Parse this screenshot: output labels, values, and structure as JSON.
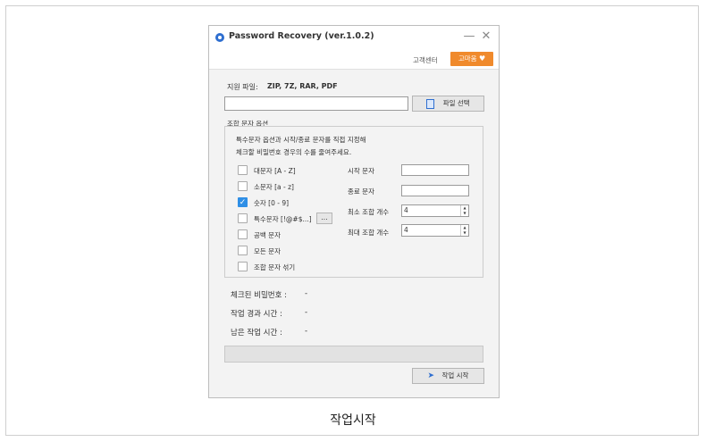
{
  "window": {
    "title": "Password Recovery (ver.1.0.2)",
    "minimize": "—",
    "close": "✕"
  },
  "header": {
    "support_label": "고객센터",
    "thanks_label": "고마움",
    "thanks_icon": "heart-icon"
  },
  "file": {
    "supported_label": "지원 파일:",
    "supported_types": "ZIP, 7Z, RAR, PDF",
    "path_value": "",
    "select_button": "파일 선택"
  },
  "options": {
    "group_title": "조합 문자 옵션",
    "description_1": "특수문자 옵션과 시작/종료 문자를 직접 지정해",
    "description_2": "체크할 비밀번호 경우의 수를 줄여주세요.",
    "checkboxes": [
      {
        "label": "대문자 [A - Z]",
        "checked": false
      },
      {
        "label": "소문자 [a - z]",
        "checked": false
      },
      {
        "label": "숫자 [0 - 9]",
        "checked": true
      },
      {
        "label": "특수문자 [!@#$...]",
        "checked": false
      },
      {
        "label": "공백 문자",
        "checked": false
      },
      {
        "label": "모든 문자",
        "checked": false
      },
      {
        "label": "조합 문자 섞기",
        "checked": false
      }
    ],
    "special_more_button": "...",
    "start_char_label": "시작 문자",
    "end_char_label": "종료 문자",
    "min_len_label": "최소 조합 개수",
    "max_len_label": "최대 조합 개수",
    "min_len_value": "4",
    "max_len_value": "4"
  },
  "status": {
    "checked_label": "체크된 비밀번호 :",
    "checked_value": "-",
    "elapsed_label": "작업 경과 시간 :",
    "elapsed_value": "-",
    "remaining_label": "남은 작업 시간 :",
    "remaining_value": "-"
  },
  "start_button": "작업 시작",
  "caption": "작업시작",
  "colors": {
    "accent": "#f08a2c",
    "check": "#2f8fe6",
    "icon": "#2f6fd0"
  }
}
